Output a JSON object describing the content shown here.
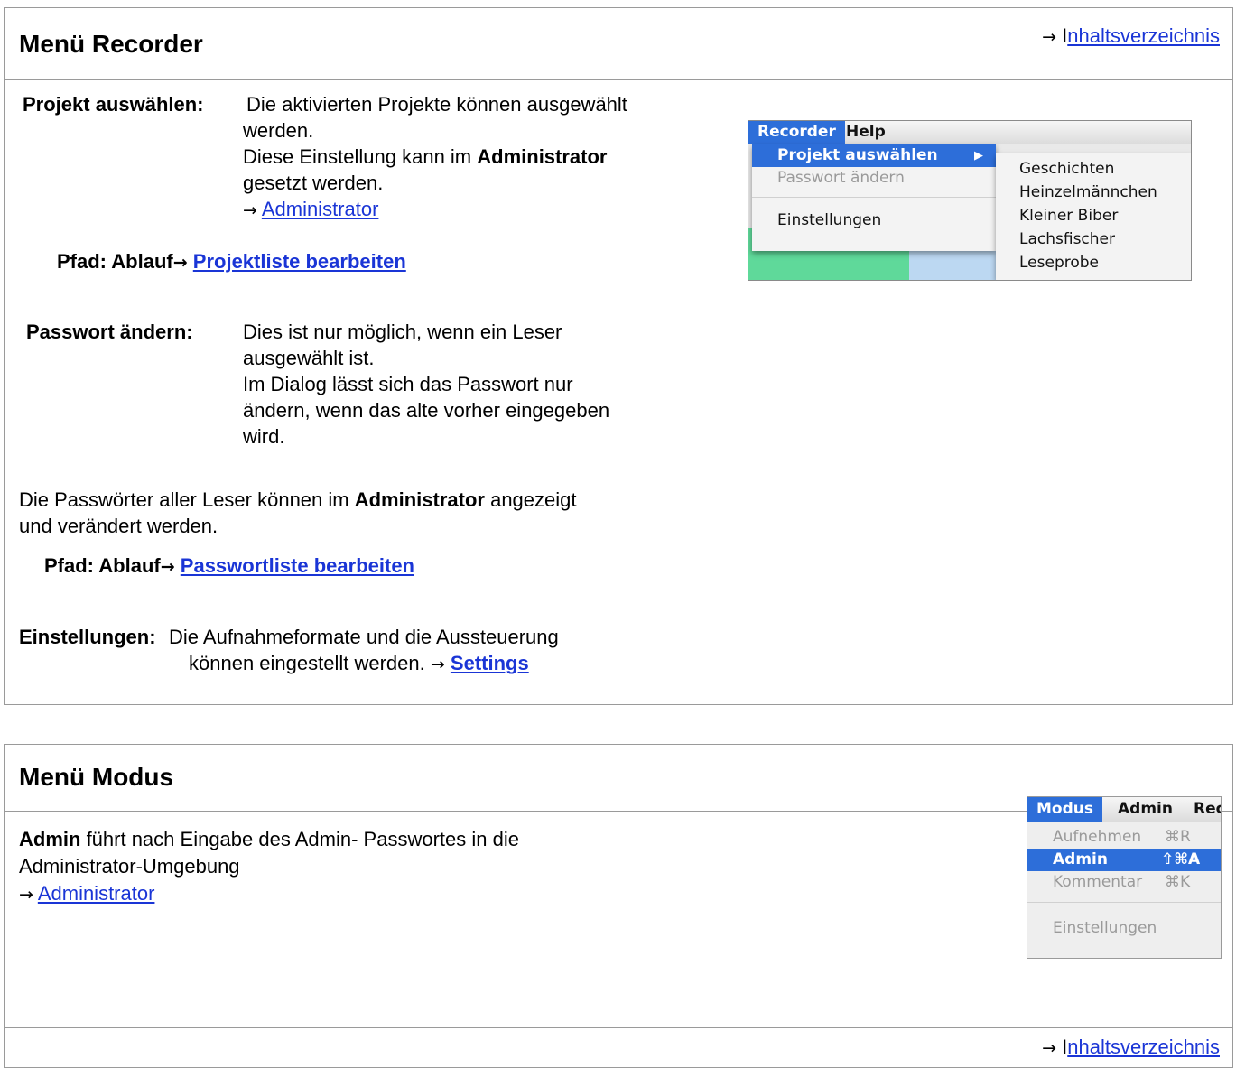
{
  "recorder_section": {
    "title": "Menü Recorder",
    "toc_prefix": "I",
    "toc_link": "nhaltsverzeichnis",
    "projekt_label": "Projekt auswählen:",
    "projekt_line1": "Die aktivierten Projekte können ausgewählt",
    "projekt_line2": "werden.",
    "projekt_line3_a": "Diese Einstellung kann im ",
    "projekt_line3_b": "Administrator",
    "projekt_line4": "gesetzt werden.",
    "projekt_link": "Administrator",
    "pfad1_label": "Pfad: Ablauf",
    "pfad1_link": "Projektliste bearbeiten",
    "passwort_label": "Passwort ändern:",
    "passwort_line1": "Dies ist nur möglich, wenn ein Leser",
    "passwort_line2": "ausgewählt ist.",
    "passwort_line3": "Im Dialog lässt sich das Passwort nur",
    "passwort_line4": "ändern, wenn das alte vorher eingegeben",
    "passwort_line5": "wird.",
    "leser_line1_a": "Die Passwörter aller Leser können im ",
    "leser_line1_b": "Administrator",
    "leser_line1_c": " angezeigt",
    "leser_line2": "und verändert werden.",
    "pfad2_label": "Pfad: Ablauf",
    "pfad2_link": "Passwortliste bearbeiten",
    "einst_label": "Einstellungen:",
    "einst_line1": "Die Aufnahmeformate und die Aussteuerung",
    "einst_line2": "können eingestellt werden. ",
    "einst_link": "Settings",
    "menu": {
      "menubar": [
        "Recorder",
        "Help"
      ],
      "items": [
        "Projekt auswählen",
        "Passwort ändern",
        "Einstellungen"
      ],
      "submenu": [
        "Geschichten",
        "Heinzelmännchen",
        "Kleiner Biber",
        "Lachsfischer",
        "Leseprobe"
      ]
    }
  },
  "modus_section": {
    "title": "Menü Modus",
    "admin_bold": "Admin",
    "admin_line1": " führt nach Eingabe des Admin- Passwortes  in die",
    "admin_line2": "Administrator-Umgebung",
    "admin_link": "Administrator",
    "toc_prefix": "I",
    "toc_link": "nhaltsverzeichnis",
    "menu": {
      "menubar": [
        "Modus",
        "Admin",
        "Rec"
      ],
      "items": [
        {
          "label": "Aufnehmen",
          "shortcut": "⌘R"
        },
        {
          "label": "Admin",
          "shortcut": "⇧⌘A"
        },
        {
          "label": "Kommentar",
          "shortcut": "⌘K"
        },
        {
          "label": "Einstellungen",
          "shortcut": ""
        }
      ]
    }
  },
  "arrow": "→"
}
